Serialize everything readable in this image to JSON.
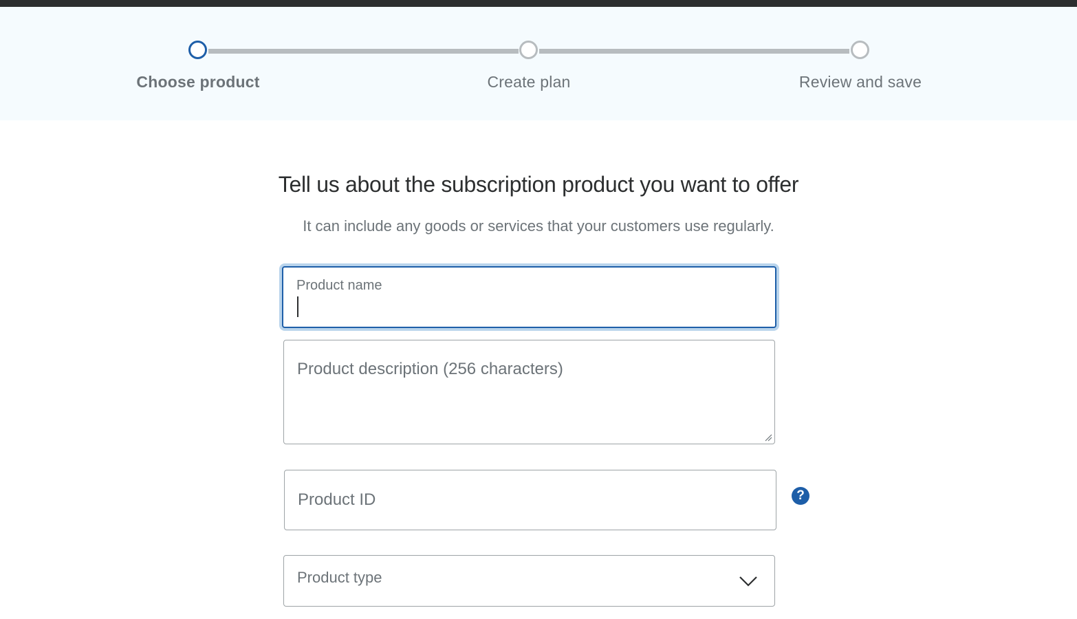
{
  "stepper": {
    "steps": [
      {
        "label": "Choose product",
        "state": "active"
      },
      {
        "label": "Create plan",
        "state": "upcoming"
      },
      {
        "label": "Review and save",
        "state": "upcoming"
      }
    ]
  },
  "form": {
    "heading": "Tell us about the subscription product you want to offer",
    "subheading": "It can include any goods or services that your customers use regularly.",
    "product_name": {
      "label": "Product name",
      "value": ""
    },
    "product_description": {
      "placeholder": "Product description (256 characters)",
      "value": ""
    },
    "product_id": {
      "placeholder": "Product ID",
      "value": ""
    },
    "product_type": {
      "placeholder": "Product type",
      "value": ""
    },
    "help_icon_glyph": "?"
  },
  "colors": {
    "accent": "#1d5ea8",
    "focus_ring": "#b9d4ec",
    "band_background": "#f5fbfe",
    "topbar": "#2c2e2f",
    "track": "#b7bcbf"
  },
  "icons": [
    "help-icon",
    "chevron-down-icon",
    "resize-grip-icon"
  ]
}
